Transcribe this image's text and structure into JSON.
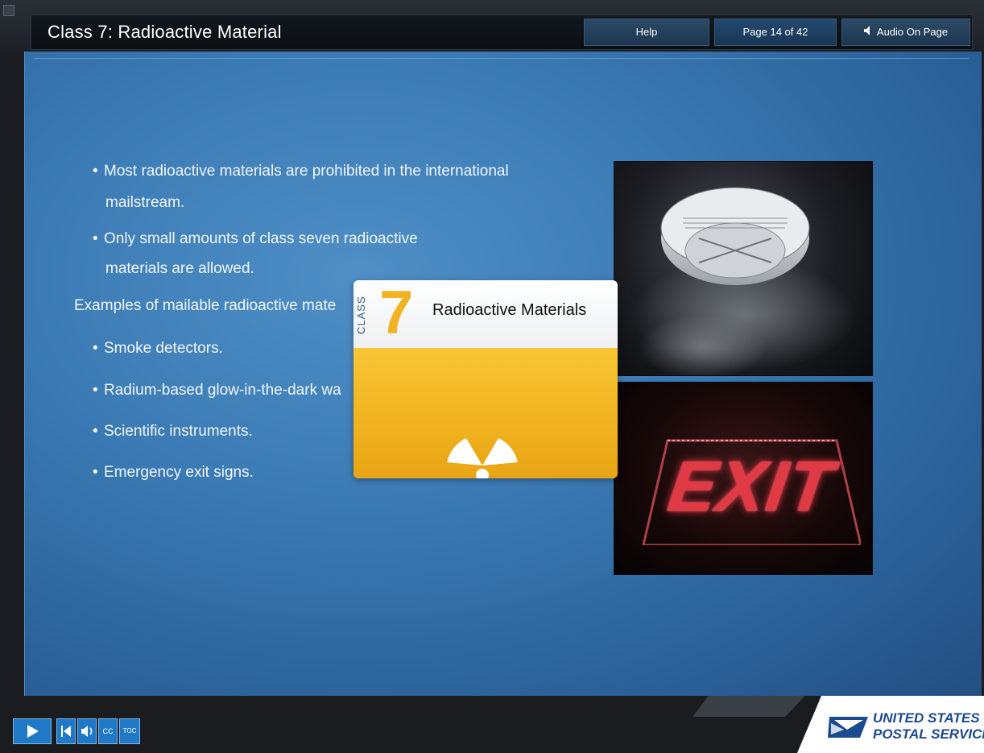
{
  "header": {
    "title": "Class 7: Radioactive Material",
    "help_label": "Help",
    "page_indicator": "Page 14 of 42",
    "audio_label": "Audio On Page"
  },
  "content": {
    "bullets": [
      {
        "line1": "Most radioactive materials are prohibited in the international",
        "line2": "mailstream."
      },
      {
        "line1": "Only small amounts of class seven radioactive",
        "line2": "materials are allowed."
      }
    ],
    "examples_heading": "Examples of mailable radioactive mate",
    "examples": [
      "Smoke detectors.",
      "Radium-based glow-in-the-dark wa",
      "Scientific instruments.",
      "Emergency exit signs."
    ]
  },
  "class_card": {
    "class_word": "CLASS",
    "class_number": "7",
    "label": "Radioactive Materials",
    "accent_color": "#f1b321"
  },
  "images": {
    "top_photo": "smoke-detector-photo",
    "bottom_photo": "exit-sign-photo",
    "exit_text": "EXIT"
  },
  "footer": {
    "controls": [
      "play-icon",
      "back-icon",
      "audio-icon",
      "CC",
      "TOC"
    ],
    "cc_label": "CC",
    "toc_label": "TOC",
    "brand_line1": "UNITED STATES",
    "brand_line2": "POSTAL SERVICE",
    "brand_mark": "®"
  },
  "colors": {
    "panel_blue": "#3a79b3",
    "header_dark": "#0b0f14",
    "button_blue": "#1f79c6",
    "usps_blue": "#1b4a8e"
  }
}
